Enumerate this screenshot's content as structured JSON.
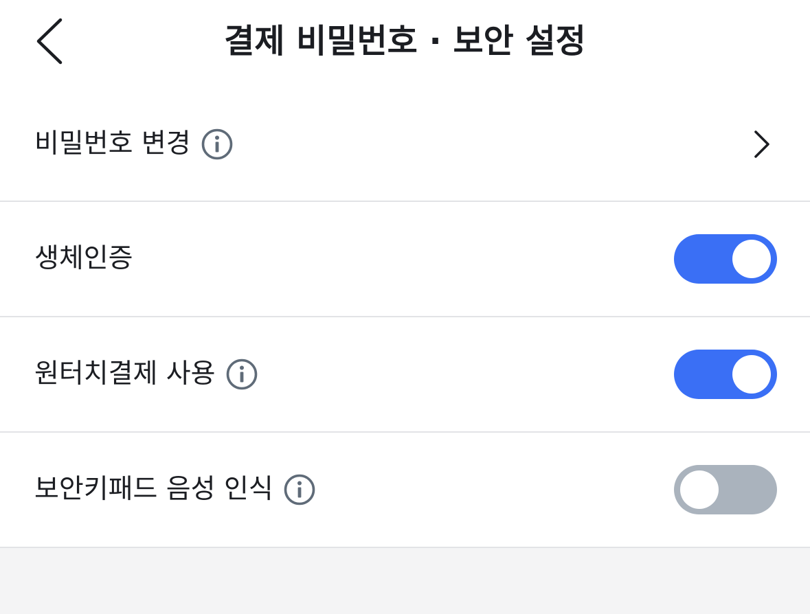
{
  "header": {
    "title": "결제 비밀번호 · 보안 설정",
    "back_icon": "chevron-left-icon"
  },
  "colors": {
    "toggle_on": "#3a6ff5",
    "toggle_off": "#aab3bd",
    "info_icon": "#5f6b78",
    "divider": "#e2e3e6",
    "background": "#f4f4f5"
  },
  "settings": {
    "items": [
      {
        "label": "비밀번호 변경",
        "has_info": true,
        "control": "chevron",
        "icon": "chevron-right-icon"
      },
      {
        "label": "생체인증",
        "has_info": false,
        "control": "toggle",
        "enabled": true
      },
      {
        "label": "원터치결제 사용",
        "has_info": true,
        "control": "toggle",
        "enabled": true
      },
      {
        "label": "보안키패드 음성 인식",
        "has_info": true,
        "control": "toggle",
        "enabled": false
      }
    ]
  }
}
